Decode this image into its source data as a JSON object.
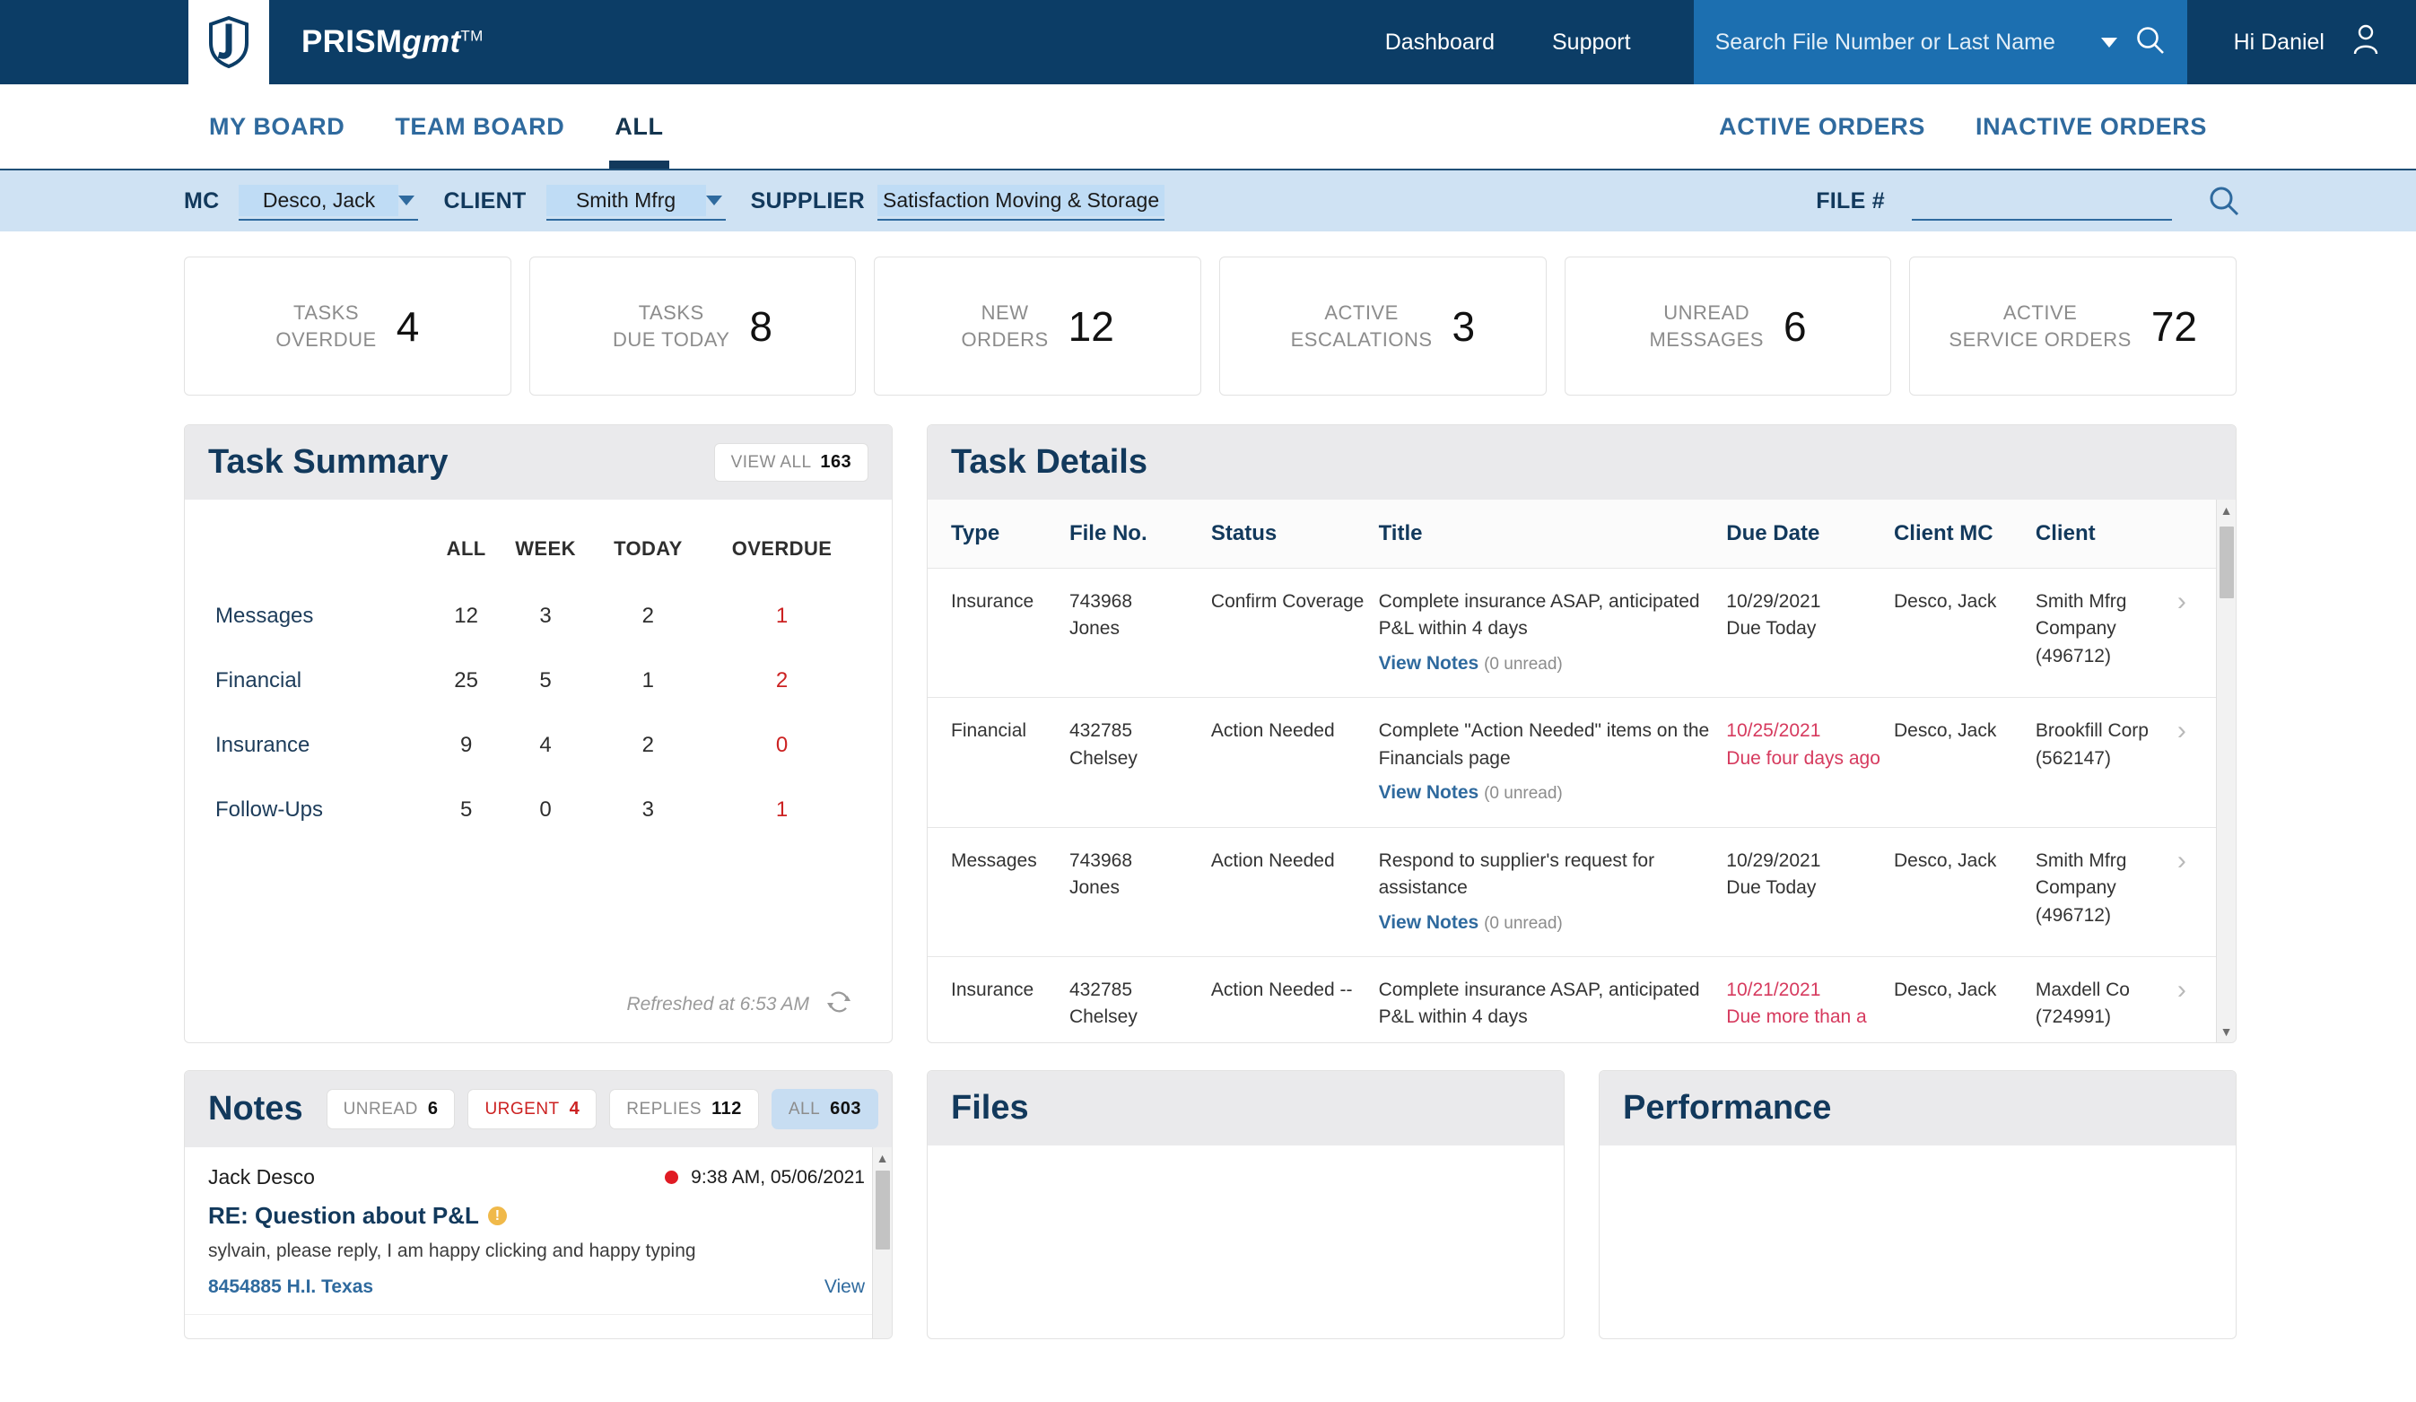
{
  "header": {
    "logo_icon": "shield-logo-icon",
    "brand": "PRISM",
    "brand_italic": "gmt",
    "brand_tm": "TM",
    "nav": [
      {
        "label": "Dashboard",
        "name": "dashboard"
      },
      {
        "label": "Support",
        "name": "support"
      }
    ],
    "search": {
      "placeholder": "Search File Number or Last Name",
      "value": "",
      "dropdown_icon": "chevron-down-icon",
      "search_icon": "search-icon",
      "bg": "#1c6fb0"
    },
    "greeting": "Hi Daniel",
    "user_icon": "user-avatar-icon",
    "bg": "#0c3d66"
  },
  "tabs": {
    "left": [
      {
        "label": "MY BOARD",
        "active": false
      },
      {
        "label": "TEAM BOARD",
        "active": false
      },
      {
        "label": "ALL",
        "active": true
      }
    ],
    "right": [
      {
        "label": "ACTIVE ORDERS",
        "active": false
      },
      {
        "label": "INACTIVE ORDERS",
        "active": false
      }
    ]
  },
  "filters": {
    "mc": {
      "label": "MC",
      "value": "Desco, Jack"
    },
    "client": {
      "label": "CLIENT",
      "value": "Smith Mfrg"
    },
    "supplier": {
      "label": "SUPPLIER",
      "value": "Satisfaction Moving & Storage"
    },
    "file": {
      "label": "FILE #",
      "value": "",
      "placeholder": ""
    },
    "search_icon": "search-icon",
    "bg": "#cfe2f3"
  },
  "kpis": [
    {
      "label_line1": "TASKS",
      "label_line2": "OVERDUE",
      "value": "4"
    },
    {
      "label_line1": "TASKS",
      "label_line2": "DUE TODAY",
      "value": "8"
    },
    {
      "label_line1": "NEW",
      "label_line2": "ORDERS",
      "value": "12"
    },
    {
      "label_line1": "ACTIVE",
      "label_line2": "ESCALATIONS",
      "value": "3"
    },
    {
      "label_line1": "UNREAD",
      "label_line2": "MESSAGES",
      "value": "6"
    },
    {
      "label_line1": "ACTIVE",
      "label_line2": "SERVICE ORDERS",
      "value": "72"
    }
  ],
  "task_summary": {
    "title": "Task Summary",
    "view_all_label": "VIEW ALL",
    "view_all_count": "163",
    "columns": [
      "",
      "ALL",
      "WEEK",
      "TODAY",
      "OVERDUE"
    ],
    "rows": [
      {
        "label": "Messages",
        "all": "12",
        "week": "3",
        "today": "2",
        "overdue": "1"
      },
      {
        "label": "Financial",
        "all": "25",
        "week": "5",
        "today": "1",
        "overdue": "2"
      },
      {
        "label": "Insurance",
        "all": "9",
        "week": "4",
        "today": "2",
        "overdue": "0"
      },
      {
        "label": "Follow-Ups",
        "all": "5",
        "week": "0",
        "today": "3",
        "overdue": "1"
      }
    ],
    "refreshed": "Refreshed at 6:53 AM",
    "refresh_icon": "refresh-icon"
  },
  "task_details": {
    "title": "Task Details",
    "columns": [
      "Type",
      "File No.",
      "Status",
      "Title",
      "Due Date",
      "Client MC",
      "Client",
      ""
    ],
    "rows": [
      {
        "type": "Insurance",
        "file_no": "743968",
        "file_name": "Jones",
        "status": "Confirm Coverage",
        "title": "Complete insurance ASAP, anticipated P&L within 4 days",
        "notes_link": "View Notes",
        "notes_count": "(0 unread)",
        "due_date": "10/29/2021",
        "due_note": "Due Today",
        "overdue": false,
        "client_mc": "Desco, Jack",
        "client": "Smith Mfrg Company (496712)",
        "chevron_icon": "chevron-right-icon"
      },
      {
        "type": "Financial",
        "file_no": "432785",
        "file_name": "Chelsey",
        "status": "Action Needed",
        "title": "Complete \"Action Needed\" items on the Financials page",
        "notes_link": "View Notes",
        "notes_count": "(0 unread)",
        "due_date": "10/25/2021",
        "due_note": "Due four days ago",
        "overdue": true,
        "client_mc": "Desco, Jack",
        "client": "Brookfill Corp (562147)",
        "chevron_icon": "chevron-right-icon"
      },
      {
        "type": "Messages",
        "file_no": "743968",
        "file_name": "Jones",
        "status": "Action Needed",
        "title": "Respond to supplier's request for assistance",
        "notes_link": "View Notes",
        "notes_count": "(0 unread)",
        "due_date": "10/29/2021",
        "due_note": "Due Today",
        "overdue": false,
        "client_mc": "Desco, Jack",
        "client": "Smith Mfrg Company (496712)",
        "chevron_icon": "chevron-right-icon"
      },
      {
        "type": "Insurance",
        "file_no": "432785",
        "file_name": "Chelsey",
        "status": "Action Needed --",
        "title": "Complete insurance ASAP, anticipated P&L within 4 days",
        "notes_link": "",
        "notes_count": "",
        "due_date": "10/21/2021",
        "due_note": "Due more than a",
        "overdue": true,
        "client_mc": "Desco, Jack",
        "client": "Maxdell Co (724991)",
        "chevron_icon": "chevron-right-icon"
      }
    ],
    "scroll_up_icon": "scroll-up-arrow-icon",
    "scroll_down_icon": "scroll-down-arrow-icon"
  },
  "notes": {
    "title": "Notes",
    "filters": [
      {
        "label": "UNREAD",
        "count": "6",
        "style": "normal",
        "selected": false
      },
      {
        "label": "URGENT",
        "count": "4",
        "style": "urgent",
        "selected": false
      },
      {
        "label": "REPLIES",
        "count": "112",
        "style": "normal",
        "selected": false
      },
      {
        "label": "ALL",
        "count": "603",
        "style": "normal",
        "selected": true
      }
    ],
    "items": [
      {
        "author": "Jack Desco",
        "unread_dot": true,
        "timestamp": "9:38 AM, 05/06/2021",
        "subject": "RE: Question about P&L",
        "urgent_icon": "urgent-exclamation-icon",
        "body": "sylvain, please reply, I am happy clicking and happy typing",
        "file_link": "8454885 H.I. Texas",
        "view_link": "View"
      }
    ]
  },
  "files": {
    "title": "Files"
  },
  "performance": {
    "title": "Performance"
  },
  "colors": {
    "header_bg": "#0c3d66",
    "search_bg": "#1c6fb0",
    "filter_bg": "#cfe2f3",
    "accent_blue": "#2f6a9e",
    "title_blue": "#12395c",
    "danger_red": "#cc2222",
    "overdue_pink": "#d63a5e"
  }
}
